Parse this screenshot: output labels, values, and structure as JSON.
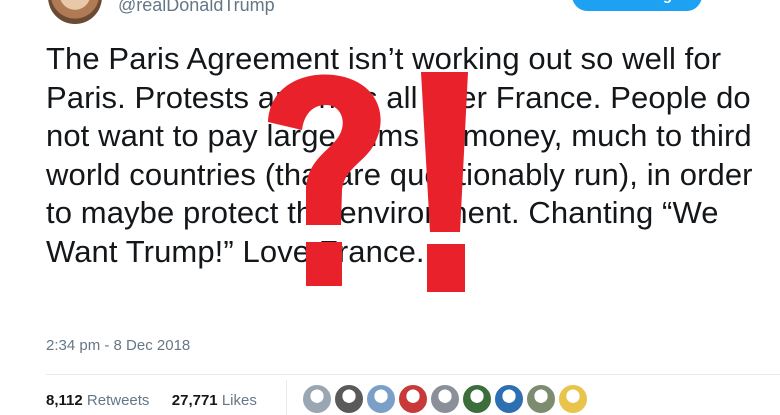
{
  "tweet": {
    "handle": "@realDonaldTrump",
    "follow_label": "Following",
    "text": "The Paris Agreement isn’t working out so well for Paris. Protests and riots all over France. People do not want to pay large sums of money, much to third world countries (that are questionably run), in order to maybe protect the environment. Chanting “We Want Trump!” Love France.",
    "timestamp": "2:34 pm - 8 Dec 2018",
    "retweets_count": "8,112",
    "retweets_label": "Retweets",
    "likes_count": "27,771",
    "likes_label": "Likes",
    "liker_avatar_colors": [
      "#9aa6b2",
      "#5a5a5a",
      "#7aa0c8",
      "#c83a3a",
      "#8a8f99",
      "#3b6e3b",
      "#2d6fb0",
      "#7d8c6e",
      "#e8c44a"
    ]
  },
  "overlay": {
    "glyphs": "?!",
    "color": "#e8212a",
    "icon": "question-exclamation-icon"
  },
  "colors": {
    "accent": "#1da1f2",
    "text": "#14171a",
    "muted": "#657786"
  }
}
